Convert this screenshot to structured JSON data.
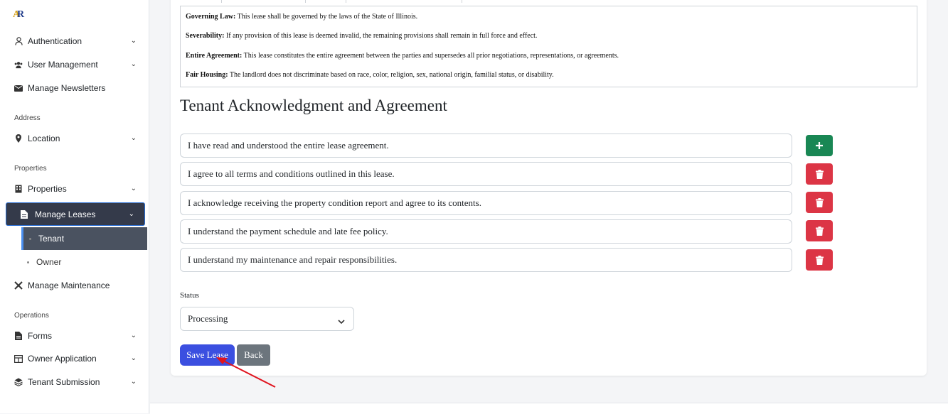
{
  "sidebar": {
    "logo_text": "AR",
    "items": [
      {
        "label": "Authentication",
        "icon": "user-icon"
      },
      {
        "label": "User Management",
        "icon": "users-icon"
      },
      {
        "label": "Manage Newsletters",
        "icon": "envelope-icon"
      }
    ],
    "section_address": "Address",
    "location": {
      "label": "Location",
      "icon": "map-pin-icon"
    },
    "section_properties": "Properties",
    "properties": {
      "label": "Properties",
      "icon": "building-icon"
    },
    "manage_leases": {
      "label": "Manage Leases",
      "icon": "file-icon"
    },
    "sub_tenant": "Tenant",
    "sub_owner": "Owner",
    "manage_maintenance": {
      "label": "Manage Maintenance",
      "icon": "tools-icon"
    },
    "section_operations": "Operations",
    "forms": {
      "label": "Forms",
      "icon": "file-icon"
    },
    "owner_application": {
      "label": "Owner Application",
      "icon": "table-icon"
    },
    "tenant_submission": {
      "label": "Tenant Submission",
      "icon": "layers-icon"
    }
  },
  "terms": [
    {
      "title": "Governing Law:",
      "text": "This lease shall be governed by the laws of the State of Illinois."
    },
    {
      "title": "Severability:",
      "text": "If any provision of this lease is deemed invalid, the remaining provisions shall remain in full force and effect."
    },
    {
      "title": "Entire Agreement:",
      "text": "This lease constitutes the entire agreement between the parties and supersedes all prior negotiations, representations, or agreements."
    },
    {
      "title": "Fair Housing:",
      "text": "The landlord does not discriminate based on race, color, religion, sex, national origin, familial status, or disability."
    }
  ],
  "ack": {
    "title": "Tenant Acknowledgment and Agreement",
    "items": [
      "I have read and understood the entire lease agreement.",
      "I agree to all terms and conditions outlined in this lease.",
      "I acknowledge receiving the property condition report and agree to its contents.",
      "I understand the payment schedule and late fee policy.",
      "I understand my maintenance and repair responsibilities."
    ]
  },
  "status": {
    "label": "Status",
    "value": "Processing"
  },
  "buttons": {
    "save": "Save Lease",
    "back": "Back"
  },
  "colors": {
    "primary": "#3b4fe0",
    "success": "#198754",
    "danger": "#dc3545",
    "secondary": "#6c757d",
    "sidebar_active": "#343a4a",
    "arrow": "#e0141e"
  }
}
